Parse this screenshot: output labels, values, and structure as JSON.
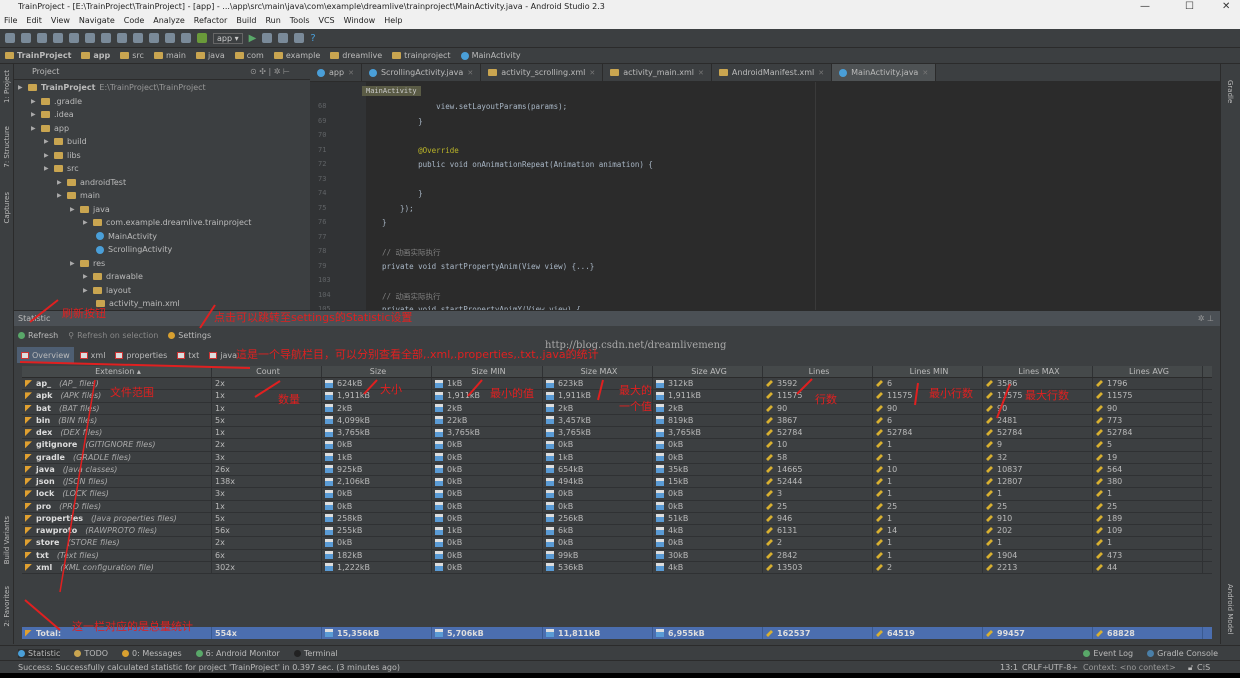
{
  "window": {
    "title": "TrainProject - [E:\\TrainProject\\TrainProject] - [app] - ...\\app\\src\\main\\java\\com\\example\\dreamlive\\trainproject\\MainActivity.java - Android Studio 2.3",
    "minimize": "—",
    "maximize": "☐",
    "close": "✕"
  },
  "menu": [
    "File",
    "Edit",
    "View",
    "Navigate",
    "Code",
    "Analyze",
    "Refactor",
    "Build",
    "Run",
    "Tools",
    "VCS",
    "Window",
    "Help"
  ],
  "toolbar": {
    "run_config": "app"
  },
  "breadcrumbs": [
    "TrainProject",
    "app",
    "src",
    "main",
    "java",
    "com",
    "example",
    "dreamlive",
    "trainproject",
    "MainActivity"
  ],
  "side_left": [
    "1: Project",
    "7: Structure",
    "Captures",
    "Build Variants",
    "2: Favorites"
  ],
  "side_right": [
    "Gradle",
    "Android Model"
  ],
  "project": {
    "header": "Project",
    "tree": [
      {
        "label": "TrainProject",
        "extra": "E:\\TrainProject\\TrainProject",
        "depth": 0,
        "icon": "folder"
      },
      {
        "label": ".gradle",
        "depth": 1,
        "icon": "folder"
      },
      {
        "label": ".idea",
        "depth": 1,
        "icon": "folder"
      },
      {
        "label": "app",
        "depth": 1,
        "icon": "folder"
      },
      {
        "label": "build",
        "depth": 2,
        "icon": "folder"
      },
      {
        "label": "libs",
        "depth": 2,
        "icon": "folder"
      },
      {
        "label": "src",
        "depth": 2,
        "icon": "folder"
      },
      {
        "label": "androidTest",
        "depth": 3,
        "icon": "folder"
      },
      {
        "label": "main",
        "depth": 3,
        "icon": "folder"
      },
      {
        "label": "java",
        "depth": 4,
        "icon": "folder"
      },
      {
        "label": "com.example.dreamlive.trainproject",
        "depth": 5,
        "icon": "folder"
      },
      {
        "label": "MainActivity",
        "depth": 6,
        "icon": "class"
      },
      {
        "label": "ScrollingActivity",
        "depth": 6,
        "icon": "class"
      },
      {
        "label": "res",
        "depth": 4,
        "icon": "folder"
      },
      {
        "label": "drawable",
        "depth": 5,
        "icon": "folder"
      },
      {
        "label": "layout",
        "depth": 5,
        "icon": "folder"
      },
      {
        "label": "activity_main.xml",
        "depth": 6,
        "icon": "xml"
      }
    ]
  },
  "editor": {
    "tabs": [
      {
        "label": "app",
        "active": false
      },
      {
        "label": "ScrollingActivity.java",
        "active": false
      },
      {
        "label": "activity_scrolling.xml",
        "active": false
      },
      {
        "label": "activity_main.xml",
        "active": false
      },
      {
        "label": "AndroidManifest.xml",
        "active": false
      },
      {
        "label": "MainActivity.java",
        "active": true
      }
    ],
    "breadcrumb": "MainActivity",
    "lines": [
      {
        "n": "68",
        "code": "            view.setLayoutParams(params);"
      },
      {
        "n": "69",
        "code": "        }"
      },
      {
        "n": "70",
        "code": ""
      },
      {
        "n": "71",
        "code": "        @Override"
      },
      {
        "n": "72",
        "code": "        public void onAnimationRepeat(Animation animation) {"
      },
      {
        "n": "73",
        "code": ""
      },
      {
        "n": "74",
        "code": "        }"
      },
      {
        "n": "75",
        "code": "    });"
      },
      {
        "n": "76",
        "code": "}"
      },
      {
        "n": "77",
        "code": ""
      },
      {
        "n": "78",
        "code": "// 动画实际执行"
      },
      {
        "n": "79",
        "code": "private void startPropertyAnim(View view) {...}"
      },
      {
        "n": "103",
        "code": ""
      },
      {
        "n": "104",
        "code": "// 动画实际执行"
      },
      {
        "n": "105",
        "code": "private void startPropertyAnimY(View view) {"
      }
    ]
  },
  "statistic": {
    "title": "Statistic",
    "refresh": "Refresh",
    "refresh_selection": "Refresh on selection",
    "settings": "Settings",
    "tabs": [
      "Overview",
      "xml",
      "properties",
      "txt",
      "java"
    ],
    "columns": [
      "Extension ▴",
      "Count",
      "Size",
      "Size MIN",
      "Size MAX",
      "Size AVG",
      "Lines",
      "Lines MIN",
      "Lines MAX",
      "Lines AVG"
    ],
    "rows": [
      [
        "ap_",
        "(AP_ files)",
        "2x",
        "624kB",
        "1kB",
        "623kB",
        "312kB",
        "3592",
        "6",
        "3586",
        "1796"
      ],
      [
        "apk",
        "(APK files)",
        "1x",
        "1,911kB",
        "1,911kB",
        "1,911kB",
        "1,911kB",
        "11575",
        "11575",
        "11575",
        "11575"
      ],
      [
        "bat",
        "(BAT files)",
        "1x",
        "2kB",
        "2kB",
        "2kB",
        "2kB",
        "90",
        "90",
        "90",
        "90"
      ],
      [
        "bin",
        "(BIN files)",
        "5x",
        "4,099kB",
        "22kB",
        "3,457kB",
        "819kB",
        "3867",
        "6",
        "2481",
        "773"
      ],
      [
        "dex",
        "(DEX files)",
        "1x",
        "3,765kB",
        "3,765kB",
        "3,765kB",
        "3,765kB",
        "52784",
        "52784",
        "52784",
        "52784"
      ],
      [
        "gitignore",
        "(GITIGNORE files)",
        "2x",
        "0kB",
        "0kB",
        "0kB",
        "0kB",
        "10",
        "1",
        "9",
        "5"
      ],
      [
        "gradle",
        "(GRADLE files)",
        "3x",
        "1kB",
        "0kB",
        "1kB",
        "0kB",
        "58",
        "1",
        "32",
        "19"
      ],
      [
        "java",
        "(Java classes)",
        "26x",
        "925kB",
        "0kB",
        "654kB",
        "35kB",
        "14665",
        "10",
        "10837",
        "564"
      ],
      [
        "json",
        "(JSON files)",
        "138x",
        "2,106kB",
        "0kB",
        "494kB",
        "15kB",
        "52444",
        "1",
        "12807",
        "380"
      ],
      [
        "lock",
        "(LOCK files)",
        "3x",
        "0kB",
        "0kB",
        "0kB",
        "0kB",
        "3",
        "1",
        "1",
        "1"
      ],
      [
        "pro",
        "(PRO files)",
        "1x",
        "0kB",
        "0kB",
        "0kB",
        "0kB",
        "25",
        "25",
        "25",
        "25"
      ],
      [
        "properties",
        "(Java properties files)",
        "5x",
        "258kB",
        "0kB",
        "256kB",
        "51kB",
        "946",
        "1",
        "910",
        "189"
      ],
      [
        "rawproto",
        "(RAWPROTO files)",
        "56x",
        "255kB",
        "1kB",
        "6kB",
        "4kB",
        "6131",
        "14",
        "202",
        "109"
      ],
      [
        "store",
        "(STORE files)",
        "2x",
        "0kB",
        "0kB",
        "0kB",
        "0kB",
        "2",
        "1",
        "1",
        "1"
      ],
      [
        "txt",
        "(Text files)",
        "6x",
        "182kB",
        "0kB",
        "99kB",
        "30kB",
        "2842",
        "1",
        "1904",
        "473"
      ],
      [
        "xml",
        "(XML configuration file)",
        "302x",
        "1,222kB",
        "0kB",
        "536kB",
        "4kB",
        "13503",
        "2",
        "2213",
        "44"
      ]
    ],
    "total": [
      "Total:",
      "554x",
      "15,356kB",
      "5,706kB",
      "11,811kB",
      "6,955kB",
      "162537",
      "64519",
      "99457",
      "68828"
    ]
  },
  "bottom_tabs": [
    "Statistic",
    "TODO",
    "0: Messages",
    "6: Android Monitor",
    "Terminal"
  ],
  "bottom_right": [
    "Event Log",
    "Gradle Console"
  ],
  "status": {
    "message": "Success: Successfully calculated statistic for project 'TrainProject' in 0.397 sec. (3 minutes ago)",
    "position": "13:1",
    "line_sep": "CRLF÷",
    "encoding": "UTF-8÷",
    "context": "Context: <no context>",
    "cs": "C⁞S"
  },
  "watermark": "http://blog.csdn.net/dreamlivemeng",
  "annotations": {
    "refresh": "刷新按钮",
    "settings": "点击可以跳转至settings的Statistic设置",
    "nav": "這是一个导航栏目，可以分别查看全部,.xml,.properties,.txt,.java的统计",
    "ext": "文件范围",
    "count": "数量",
    "size": "大小",
    "min": "最小的值",
    "max": "最大的",
    "max2": "一个值",
    "lines": "行数",
    "lmin": "最小行数",
    "lmax": "最大行数",
    "total": "这一栏对应的是总量统计"
  },
  "colors": {
    "total_row": "#4b6eaf",
    "annotation": "#e02020",
    "background": "#3c3f41"
  }
}
